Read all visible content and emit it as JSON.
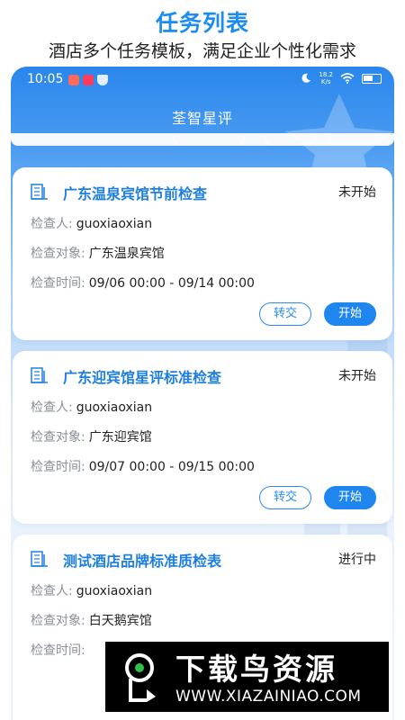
{
  "promo": {
    "title": "任务列表",
    "subtitle": "酒店多个任务模板，满足企业个性化需求"
  },
  "status_bar": {
    "time": "10:05",
    "net_speed_value": "18.2",
    "net_speed_unit": "K/s"
  },
  "app": {
    "title": "荃智星评"
  },
  "labels": {
    "inspector": "检查人:",
    "target": "检查对象:",
    "time": "检查时间:"
  },
  "tasks": [
    {
      "title": "广东温泉宾馆节前检查",
      "status": "未开始",
      "inspector": "guoxiaoxian",
      "target": "广东温泉宾馆",
      "time": "09/06 00:00 - 09/14 00:00",
      "transfer_label": "转交",
      "start_label": "开始"
    },
    {
      "title": "广东迎宾馆星评标准检查",
      "status": "未开始",
      "inspector": "guoxiaoxian",
      "target": "广东迎宾馆",
      "time": "09/07 00:00 - 09/15 00:00",
      "transfer_label": "转交",
      "start_label": "开始"
    },
    {
      "title": "测试酒店品牌标准质检表",
      "status": "进行中",
      "inspector": "guoxiaoxian",
      "target": "白天鹅宾馆"
    }
  ],
  "watermark": {
    "brand": "下载鸟资源",
    "url": "WWW.XIAZAINIAO.COM"
  },
  "colors": {
    "accent": "#1f86ef",
    "title_blue": "#1e7fe0",
    "label_gray": "#8a8f99"
  },
  "icons": [
    "moon-icon",
    "wifi-icon",
    "battery-icon",
    "document-icon"
  ]
}
